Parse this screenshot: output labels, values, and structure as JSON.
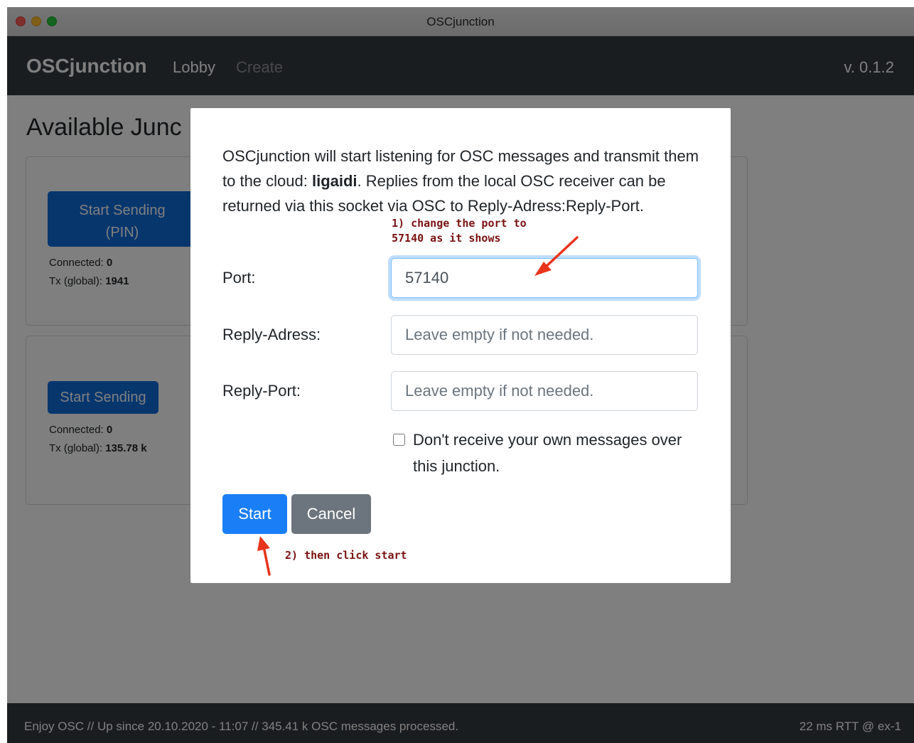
{
  "window": {
    "title": "OSCjunction"
  },
  "navbar": {
    "brand": "OSCjunction",
    "lobby": "Lobby",
    "create": "Create",
    "version": "v. 0.1.2"
  },
  "page": {
    "title": "Available Junc",
    "cards": [
      {
        "button_line1": "Start Sending",
        "button_line2": "(PIN)",
        "connected_label": "Connected:",
        "connected_value": "0",
        "tx_label": "Tx (global):",
        "tx_value": "1941"
      },
      {
        "button": "Start Sending",
        "connected_label": "Connected:",
        "connected_value": "0",
        "tx_label": "Tx (global):",
        "tx_value": "135.78 k"
      }
    ]
  },
  "modal": {
    "text_before": "OSCjunction will start listening for OSC messages and transmit them to the cloud: ",
    "cloud_name": "ligaidi",
    "text_after": ". Replies from the local OSC receiver can be returned via this socket via OSC to Reply-Adress:Reply-Port.",
    "port_label": "Port:",
    "port_value": "57140",
    "reply_address_label": "Reply-Adress:",
    "reply_address_placeholder": "Leave empty if not needed.",
    "reply_port_label": "Reply-Port:",
    "reply_port_placeholder": "Leave empty if not needed.",
    "checkbox_label": "Don't receive your own messages over this junction.",
    "checkbox_checked": false,
    "start_button": "Start",
    "cancel_button": "Cancel"
  },
  "annotations": {
    "step1": "1) change the port to\n57140 as it shows",
    "step2": "2) then click start",
    "color": "#e8341c"
  },
  "footer": {
    "left": "Enjoy OSC // Up since 20.10.2020 - 11:07 // 345.41 k OSC messages processed.",
    "right": "22 ms RTT @ ex-1"
  }
}
